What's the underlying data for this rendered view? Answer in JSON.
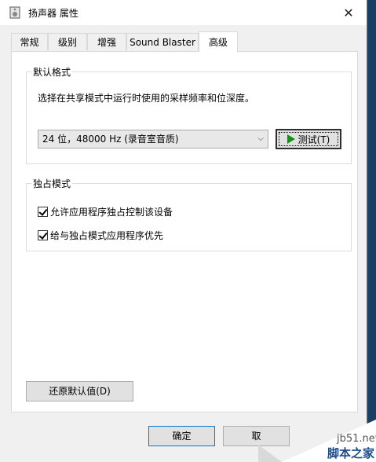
{
  "window": {
    "title": "扬声器 属性",
    "close_glyph": "✕"
  },
  "tabs": [
    {
      "label": "常规"
    },
    {
      "label": "级别"
    },
    {
      "label": "增强"
    },
    {
      "label": "Sound Blaster"
    },
    {
      "label": "高级",
      "active": true
    }
  ],
  "default_format": {
    "title": "默认格式",
    "description": "选择在共享模式中运行时使用的采样频率和位深度。",
    "selected": "24 位，48000 Hz (录音室音质)",
    "test_label": "测试(T)"
  },
  "exclusive_mode": {
    "title": "独占模式",
    "allow_exclusive_label": "允许应用程序独占控制该设备",
    "allow_exclusive_checked": true,
    "priority_label": "给与独占模式应用程序优先",
    "priority_checked": true
  },
  "restore_defaults_label": "还原默认值(D)",
  "footer": {
    "ok_label": "确定",
    "cancel_label": "取"
  },
  "watermark": {
    "site": "jb51.net",
    "brand": "脚本之家"
  },
  "colors": {
    "accent": "#0078d7",
    "play": "#1a8c1a"
  }
}
